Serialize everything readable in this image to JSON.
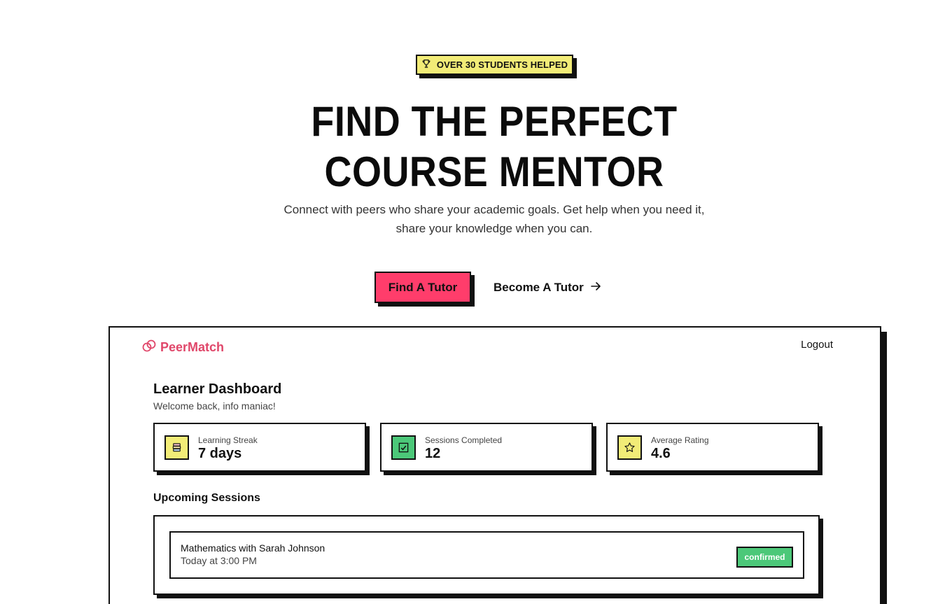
{
  "hero": {
    "badge_text": "OVER 30 STUDENTS HELPED",
    "badge_icon": "trophy-icon",
    "title_line1": "FIND THE PERFECT",
    "title_line2": "COURSE MENTOR",
    "subtitle_line1": "Connect with peers who share your academic goals. Get help when you need it,",
    "subtitle_line2": "share your knowledge when you can.",
    "primary_cta": "Find A Tutor",
    "secondary_cta": "Become A Tutor"
  },
  "app": {
    "logo_text": "PeerMatch",
    "logout_label": "Logout",
    "dashboard_title": "Learner Dashboard",
    "welcome_text": "Welcome back, info maniac!",
    "stats": [
      {
        "label": "Learning Streak",
        "value": "7 days",
        "icon": "books-icon",
        "color": "#f2ec77"
      },
      {
        "label": "Sessions Completed",
        "value": "12",
        "icon": "check-icon",
        "color": "#4cc879"
      },
      {
        "label": "Average Rating",
        "value": "4.6",
        "icon": "star-icon",
        "color": "#f2ec77"
      }
    ],
    "upcoming_title": "Upcoming Sessions",
    "sessions": [
      {
        "title": "Mathematics with Sarah Johnson",
        "time": "Today at 3:00 PM",
        "status": "confirmed"
      }
    ]
  },
  "colors": {
    "accent_pink": "#ff3d6b",
    "badge_yellow": "#f2ec77",
    "status_green": "#4cc879",
    "logo_pink": "#e0476a"
  }
}
